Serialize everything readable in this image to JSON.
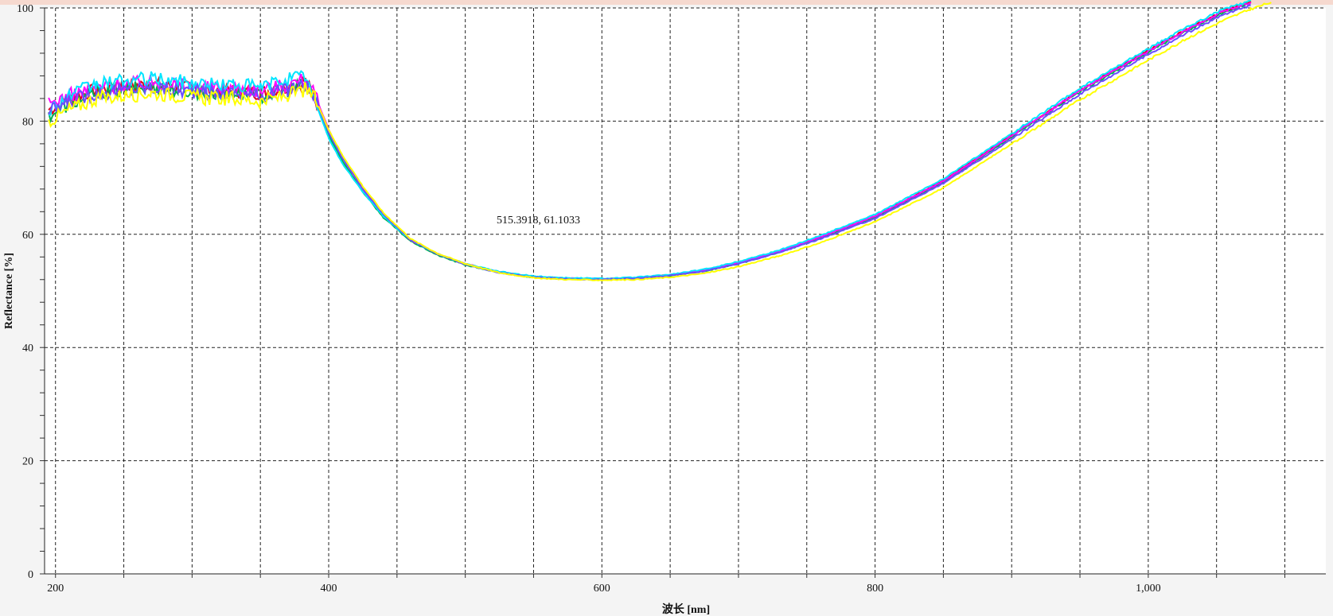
{
  "chart_data": {
    "type": "line",
    "xlabel": "波长 [nm]",
    "ylabel": "Reflectance [%]",
    "xlim": [
      192,
      1130
    ],
    "ylim": [
      0,
      100
    ],
    "x_ticks": [
      200,
      400,
      600,
      800,
      1000
    ],
    "x_tick_labels": [
      "200",
      "400",
      "600",
      "800",
      "1,000"
    ],
    "y_ticks": [
      0,
      20,
      40,
      60,
      80,
      100
    ],
    "y_tick_labels": [
      "0",
      "20",
      "40",
      "60",
      "80",
      "100"
    ],
    "grid": true,
    "annotation": "515.3918, 61.1033",
    "colors": [
      "#e0001b",
      "#00b050",
      "#ff00ff",
      "#00e5ff",
      "#6a4cff",
      "#ffff00"
    ],
    "series": [
      {
        "color": "#e0001b",
        "x": [
          195,
          210,
          230,
          250,
          270,
          290,
          310,
          330,
          350,
          370,
          383,
          390,
          400,
          410,
          425,
          440,
          460,
          480,
          500,
          525,
          550,
          575,
          600,
          625,
          650,
          675,
          700,
          730,
          760,
          800,
          850,
          900,
          950,
          1000,
          1030,
          1055,
          1075
        ],
        "values": [
          82,
          84,
          85.5,
          86,
          86.5,
          86,
          85.5,
          85.5,
          85,
          86,
          87,
          84,
          78,
          73.5,
          68,
          63.5,
          59,
          56.5,
          54.8,
          53.3,
          52.5,
          52.2,
          52.1,
          52.3,
          52.8,
          53.6,
          55,
          57,
          59.5,
          63.2,
          69.5,
          77.5,
          85.5,
          92.5,
          96.5,
          99.5,
          101
        ]
      },
      {
        "color": "#00b050",
        "x": [
          195,
          210,
          230,
          250,
          270,
          290,
          310,
          330,
          350,
          370,
          383,
          390,
          400,
          410,
          425,
          440,
          460,
          480,
          500,
          525,
          550,
          575,
          600,
          625,
          650,
          675,
          700,
          730,
          760,
          800,
          850,
          900,
          950,
          1000,
          1030,
          1055,
          1075
        ],
        "values": [
          81,
          83,
          85,
          85.5,
          86,
          85.5,
          85,
          85,
          84.5,
          85.5,
          86.5,
          84,
          77.5,
          73,
          67.5,
          63,
          58.8,
          56.3,
          54.6,
          53.2,
          52.4,
          52.1,
          52,
          52.2,
          52.7,
          53.5,
          54.8,
          56.8,
          59.3,
          63,
          69.2,
          77.2,
          85.2,
          92.2,
          96.2,
          99.2,
          100.8
        ]
      },
      {
        "color": "#ff00ff",
        "x": [
          195,
          210,
          230,
          250,
          270,
          290,
          310,
          330,
          350,
          370,
          383,
          390,
          400,
          410,
          425,
          440,
          460,
          480,
          500,
          525,
          550,
          575,
          600,
          625,
          650,
          675,
          700,
          730,
          760,
          800,
          850,
          900,
          950,
          1000,
          1030,
          1055,
          1075
        ],
        "values": [
          83,
          84.5,
          86,
          86.5,
          87,
          86.5,
          86,
          86,
          85.5,
          86.5,
          87.5,
          84.5,
          78.5,
          73.5,
          68,
          63.5,
          59,
          56.5,
          54.8,
          53.3,
          52.5,
          52.2,
          52.1,
          52.3,
          52.8,
          53.6,
          55,
          57,
          59.5,
          63.2,
          69.4,
          77.4,
          85.4,
          92.4,
          96.4,
          99.4,
          101
        ]
      },
      {
        "color": "#00e5ff",
        "x": [
          195,
          210,
          230,
          250,
          270,
          290,
          310,
          330,
          350,
          370,
          383,
          390,
          400,
          410,
          425,
          440,
          460,
          480,
          500,
          525,
          550,
          575,
          600,
          625,
          650,
          675,
          700,
          730,
          760,
          800,
          850,
          900,
          950,
          1000,
          1030,
          1055,
          1075
        ],
        "values": [
          82,
          84.5,
          86.5,
          87,
          87.5,
          87,
          86.5,
          86.5,
          86,
          87.5,
          88,
          83.5,
          77,
          72.5,
          67.5,
          63.2,
          59,
          56.5,
          54.8,
          53.4,
          52.6,
          52.3,
          52.2,
          52.4,
          52.9,
          53.8,
          55.2,
          57.2,
          59.8,
          63.5,
          69.8,
          77.8,
          85.8,
          92.8,
          96.8,
          99.8,
          101.2
        ]
      },
      {
        "color": "#6a4cff",
        "x": [
          195,
          210,
          230,
          250,
          270,
          290,
          310,
          330,
          350,
          370,
          383,
          390,
          400,
          410,
          425,
          440,
          460,
          480,
          500,
          525,
          550,
          575,
          600,
          625,
          650,
          675,
          700,
          730,
          760,
          800,
          850,
          900,
          950,
          1000,
          1030,
          1055,
          1075
        ],
        "values": [
          81.5,
          83.5,
          85,
          85.5,
          86,
          85.5,
          85,
          85,
          84.5,
          85.5,
          86.5,
          84,
          78,
          73.5,
          68,
          63.5,
          59,
          56.5,
          54.7,
          53.2,
          52.4,
          52.1,
          52,
          52.2,
          52.7,
          53.5,
          54.8,
          56.8,
          59.2,
          62.8,
          69,
          76.8,
          84.8,
          91.8,
          95.8,
          98.8,
          100.5
        ]
      },
      {
        "color": "#ffff00",
        "x": [
          195,
          210,
          230,
          250,
          270,
          290,
          310,
          330,
          350,
          370,
          383,
          390,
          400,
          410,
          425,
          440,
          460,
          480,
          500,
          525,
          550,
          575,
          600,
          625,
          650,
          675,
          700,
          730,
          760,
          800,
          850,
          900,
          950,
          1000,
          1030,
          1055,
          1075,
          1090
        ],
        "values": [
          80,
          82,
          84,
          84.5,
          85,
          84.5,
          84,
          84,
          83.5,
          84.5,
          85.5,
          84,
          78.5,
          74,
          68.5,
          63.8,
          59.2,
          56.6,
          54.8,
          53.2,
          52.3,
          52,
          51.9,
          52,
          52.4,
          53.1,
          54.3,
          56.2,
          58.5,
          62.2,
          68.2,
          76,
          83.8,
          90.8,
          94.8,
          97.8,
          99.8,
          101
        ]
      }
    ]
  }
}
